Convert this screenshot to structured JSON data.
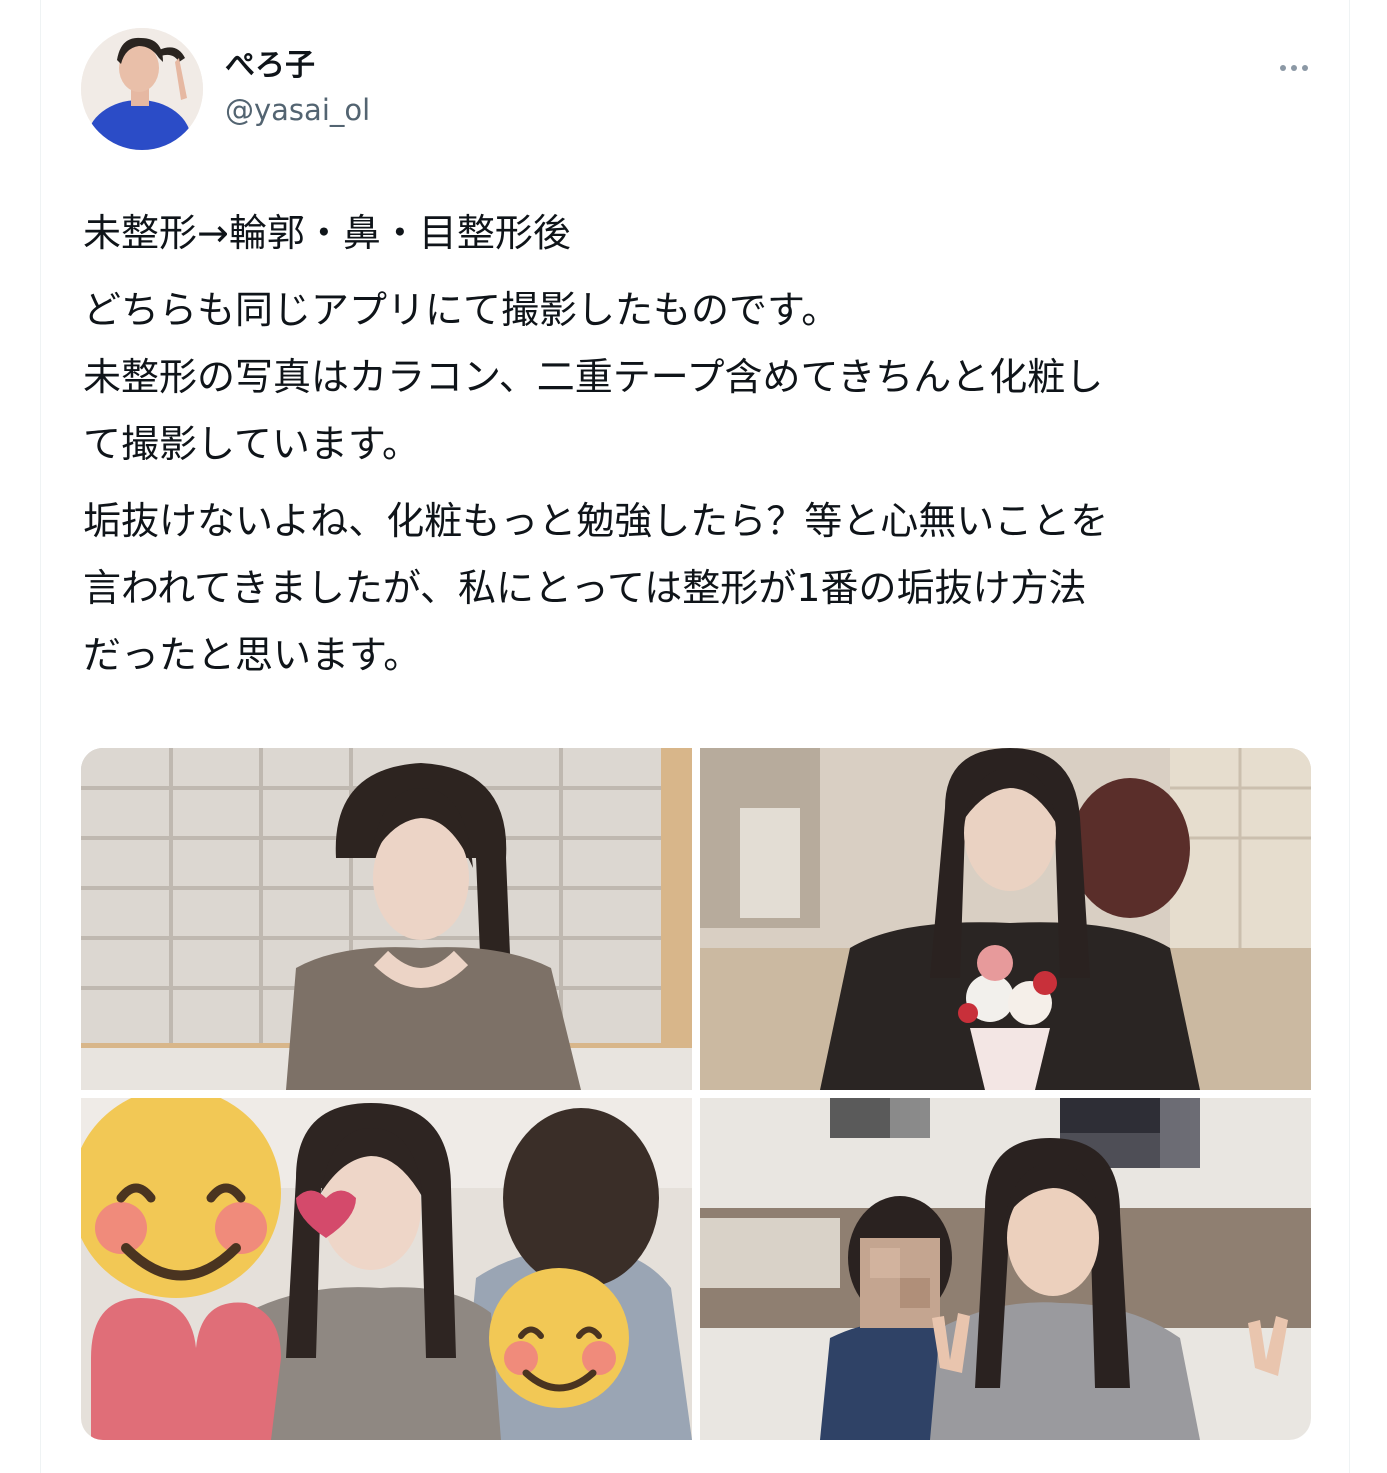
{
  "tweet": {
    "author": {
      "display_name": "ぺろ子",
      "handle": "@yasai_ol"
    },
    "paragraphs": [
      "未整形→輪郭・鼻・目整形後",
      "どちらも同じアプリにて撮影したものです。\n未整形の写真はカラコン、二重テープ含めてきちんと化粧し\nて撮影しています。",
      "垢抜けないよね、化粧もっと勉強したら？等と心無いことを\n言われてきましたが、私にとっては整形が1番の垢抜け方法\nだったと思います。"
    ],
    "more_icon": "more-horizontal-icon"
  },
  "media": {
    "photos": [
      {
        "name": "photo-1",
        "description_icon": "photo-woman-grey-top"
      },
      {
        "name": "photo-2",
        "description_icon": "photo-woman-parfait"
      },
      {
        "name": "photo-3",
        "description_icon": "photo-friends-emoji"
      },
      {
        "name": "photo-4",
        "description_icon": "photo-friends-peace"
      }
    ]
  },
  "colors": {
    "handle": "#536471",
    "text": "#0f1419",
    "border": "#eff3f4"
  }
}
